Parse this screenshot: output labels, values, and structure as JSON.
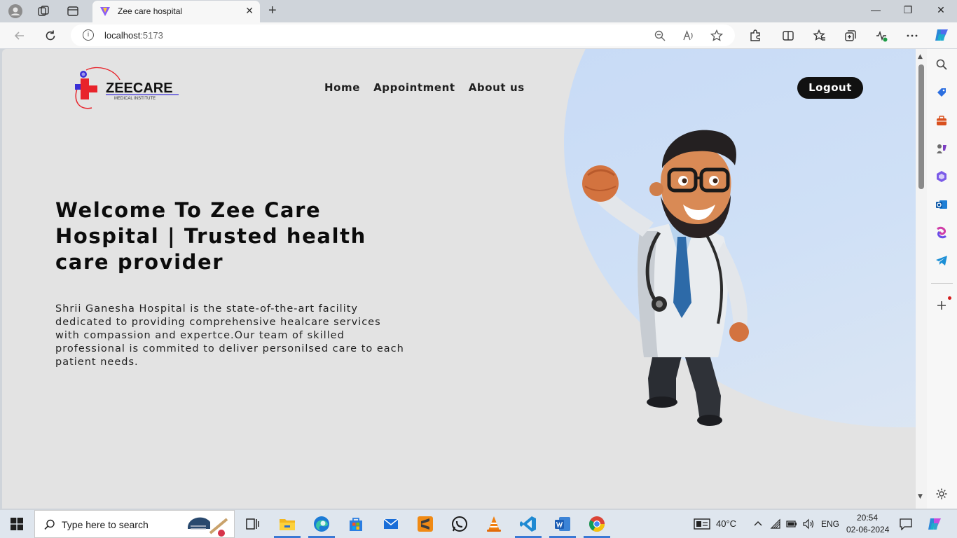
{
  "browser": {
    "tab_title": "Zee care hospital",
    "new_tab_symbol": "+",
    "tab_close_symbol": "✕",
    "url_host": "localhost",
    "url_port": ":5173",
    "url_info_symbol": "i",
    "window_controls": {
      "minimize": "—",
      "maximize": "❐",
      "close": "✕"
    }
  },
  "site": {
    "logo": {
      "brand": "ZEECARE",
      "tagline": "MEDICAL INSTITUTE"
    },
    "nav": [
      {
        "label": "Home"
      },
      {
        "label": "Appointment"
      },
      {
        "label": "About us"
      }
    ],
    "logout_label": "Logout",
    "hero": {
      "title": "Welcome To Zee Care Hospital | Trusted health care provider",
      "description": "Shrii Ganesha Hospital is the state-of-the-art facility dedicated to providing comprehensive healcare services with compassion and expertce.Our team of skilled professional is commited to deliver personilsed care to each patient needs."
    },
    "colors": {
      "page_bg": "#e3e3e3",
      "accent_blob": "#c4d8f6",
      "button_bg": "#111111",
      "logo_red": "#e8232b",
      "logo_blue": "#3a2fd6"
    }
  },
  "taskbar": {
    "search_placeholder": "Type here to search",
    "temperature": "40°C",
    "language": "ENG",
    "time": "20:54",
    "date": "02-06-2024"
  },
  "icons": [
    "profile-icon",
    "workspaces-icon",
    "tab-actions-icon",
    "back-icon",
    "refresh-icon",
    "zoom-icon",
    "read-aloud-icon",
    "favorite-star-icon",
    "extensions-icon",
    "split-screen-icon",
    "favorites-icon",
    "collections-icon",
    "performance-icon",
    "more-icon",
    "copilot-icon",
    "search-sidebar-icon",
    "shopping-icon",
    "tools-icon",
    "games-icon",
    "office-icon",
    "outlook-icon",
    "m365-icon",
    "telegram-icon",
    "add-sidebar-icon",
    "settings-icon",
    "windows-start-icon",
    "task-view-icon",
    "file-explorer-icon",
    "edge-icon",
    "store-icon",
    "mail-icon",
    "sublime-icon",
    "whatsapp-icon",
    "vlc-icon",
    "vscode-icon",
    "word-icon",
    "chrome-icon"
  ]
}
